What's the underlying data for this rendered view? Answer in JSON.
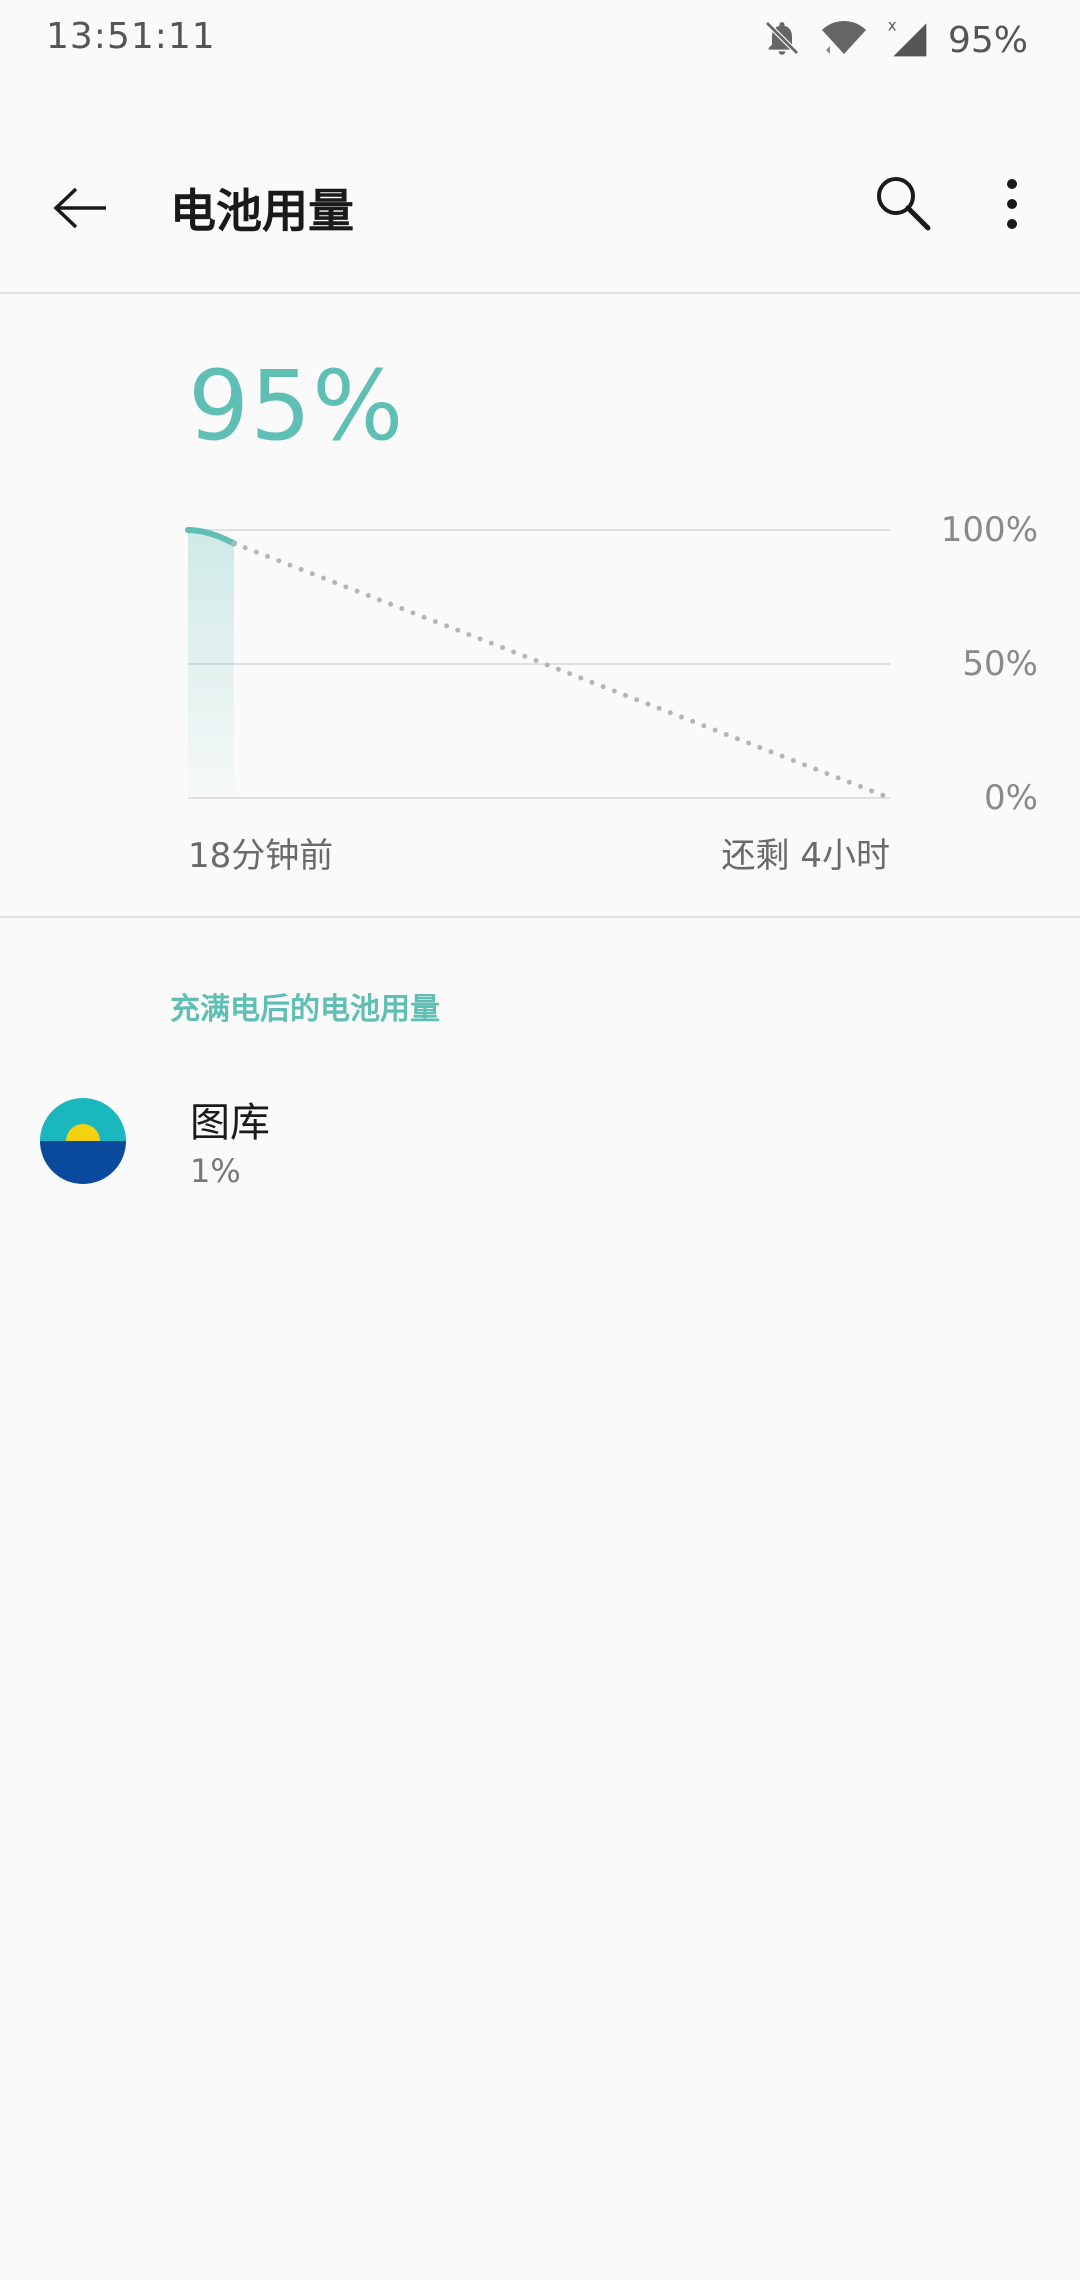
{
  "status_bar": {
    "time": "13:51:11",
    "battery": "95%",
    "icons": [
      "notifications-off-icon",
      "wifi-icon",
      "signal-icon"
    ]
  },
  "toolbar": {
    "title": "电池用量",
    "back_icon": "back-arrow-icon",
    "search_icon": "search-icon",
    "more_icon": "more-vert-icon"
  },
  "battery": {
    "level": "95%"
  },
  "chart_data": {
    "type": "line",
    "y_ticks": [
      "100%",
      "50%",
      "0%"
    ],
    "ylim": [
      0,
      100
    ],
    "x_start_label": "18分钟前",
    "x_end_label": "还剩 4小时",
    "series": [
      {
        "values": [
          100,
          95
        ],
        "style": "solid"
      },
      {
        "values": [
          95,
          0
        ],
        "style": "dotted"
      }
    ],
    "colors": {
      "actual": "#5fbfb5",
      "projection": "#b5b5b5",
      "grid": "#e0e0e0"
    }
  },
  "section": {
    "header": "充满电后的电池用量"
  },
  "apps": [
    {
      "name": "图库",
      "usage": "1%",
      "icon": "gallery-app-icon"
    }
  ]
}
